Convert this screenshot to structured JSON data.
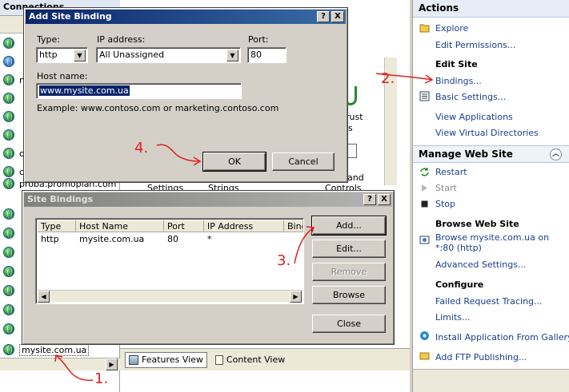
{
  "tree": {
    "header": "Connections",
    "items": [
      {
        "label": ""
      },
      {
        "label": ""
      },
      {
        "label": "n"
      },
      {
        "label": ""
      },
      {
        "label": ""
      },
      {
        "label": ""
      },
      {
        "label": ""
      },
      {
        "label": "n"
      },
      {
        "label": "n"
      },
      {
        "label": "n"
      },
      {
        "label": "n"
      },
      {
        "label": "o"
      },
      {
        "label": "c"
      },
      {
        "label": "proba.promoplan.com"
      }
    ],
    "selected": "mysite.com.ua"
  },
  "middle": {
    "features": [
      "Settings",
      "Strings",
      "Controls",
      "rust",
      "ls",
      "and"
    ],
    "features_view": "Features View",
    "content_view": "Content View"
  },
  "actions": {
    "title": "Actions",
    "explore": "Explore",
    "edit_permissions": "Edit Permissions...",
    "edit_site": "Edit Site",
    "bindings": "Bindings...",
    "basic_settings": "Basic Settings...",
    "view_applications": "View Applications",
    "view_virtual_dirs": "View Virtual Directories",
    "manage_web_site": "Manage Web Site",
    "restart": "Restart",
    "start": "Start",
    "stop": "Stop",
    "browse_web_site": "Browse Web Site",
    "browse_link_1": "Browse mysite.com.ua on",
    "browse_link_2": "*:80 (http)",
    "advanced_settings": "Advanced Settings...",
    "configure": "Configure",
    "failed_request": "Failed Request Tracing...",
    "limits": "Limits...",
    "install_app": "Install Application From Gallery",
    "add_ftp": "Add FTP Publishing..."
  },
  "add_binding": {
    "title": "Add Site Binding",
    "type_label": "Type:",
    "type_value": "http",
    "ip_label": "IP address:",
    "ip_value": "All Unassigned",
    "port_label": "Port:",
    "port_value": "80",
    "host_label": "Host name:",
    "host_value": "www.mysite.com.ua",
    "example": "Example: www.contoso.com or marketing.contoso.com",
    "ok": "OK",
    "cancel": "Cancel",
    "help_btn": "?",
    "close_btn": "X"
  },
  "site_bindings": {
    "title": "Site Bindings",
    "columns": [
      "Type",
      "Host Name",
      "Port",
      "IP Address",
      "Bind"
    ],
    "rows": [
      {
        "type": "http",
        "host": "mysite.com.ua",
        "port": "80",
        "ip": "*"
      }
    ],
    "add": "Add...",
    "edit": "Edit...",
    "remove": "Remove",
    "browse": "Browse",
    "close": "Close",
    "help_btn": "?",
    "close_btn": "X"
  },
  "annotations": {
    "step1": "1.",
    "step2": "2.",
    "step3": "3.",
    "step4": "4."
  },
  "colors": {
    "annotation": "#e02020",
    "title_active": "#0a246a",
    "link": "#1a3e8c"
  }
}
